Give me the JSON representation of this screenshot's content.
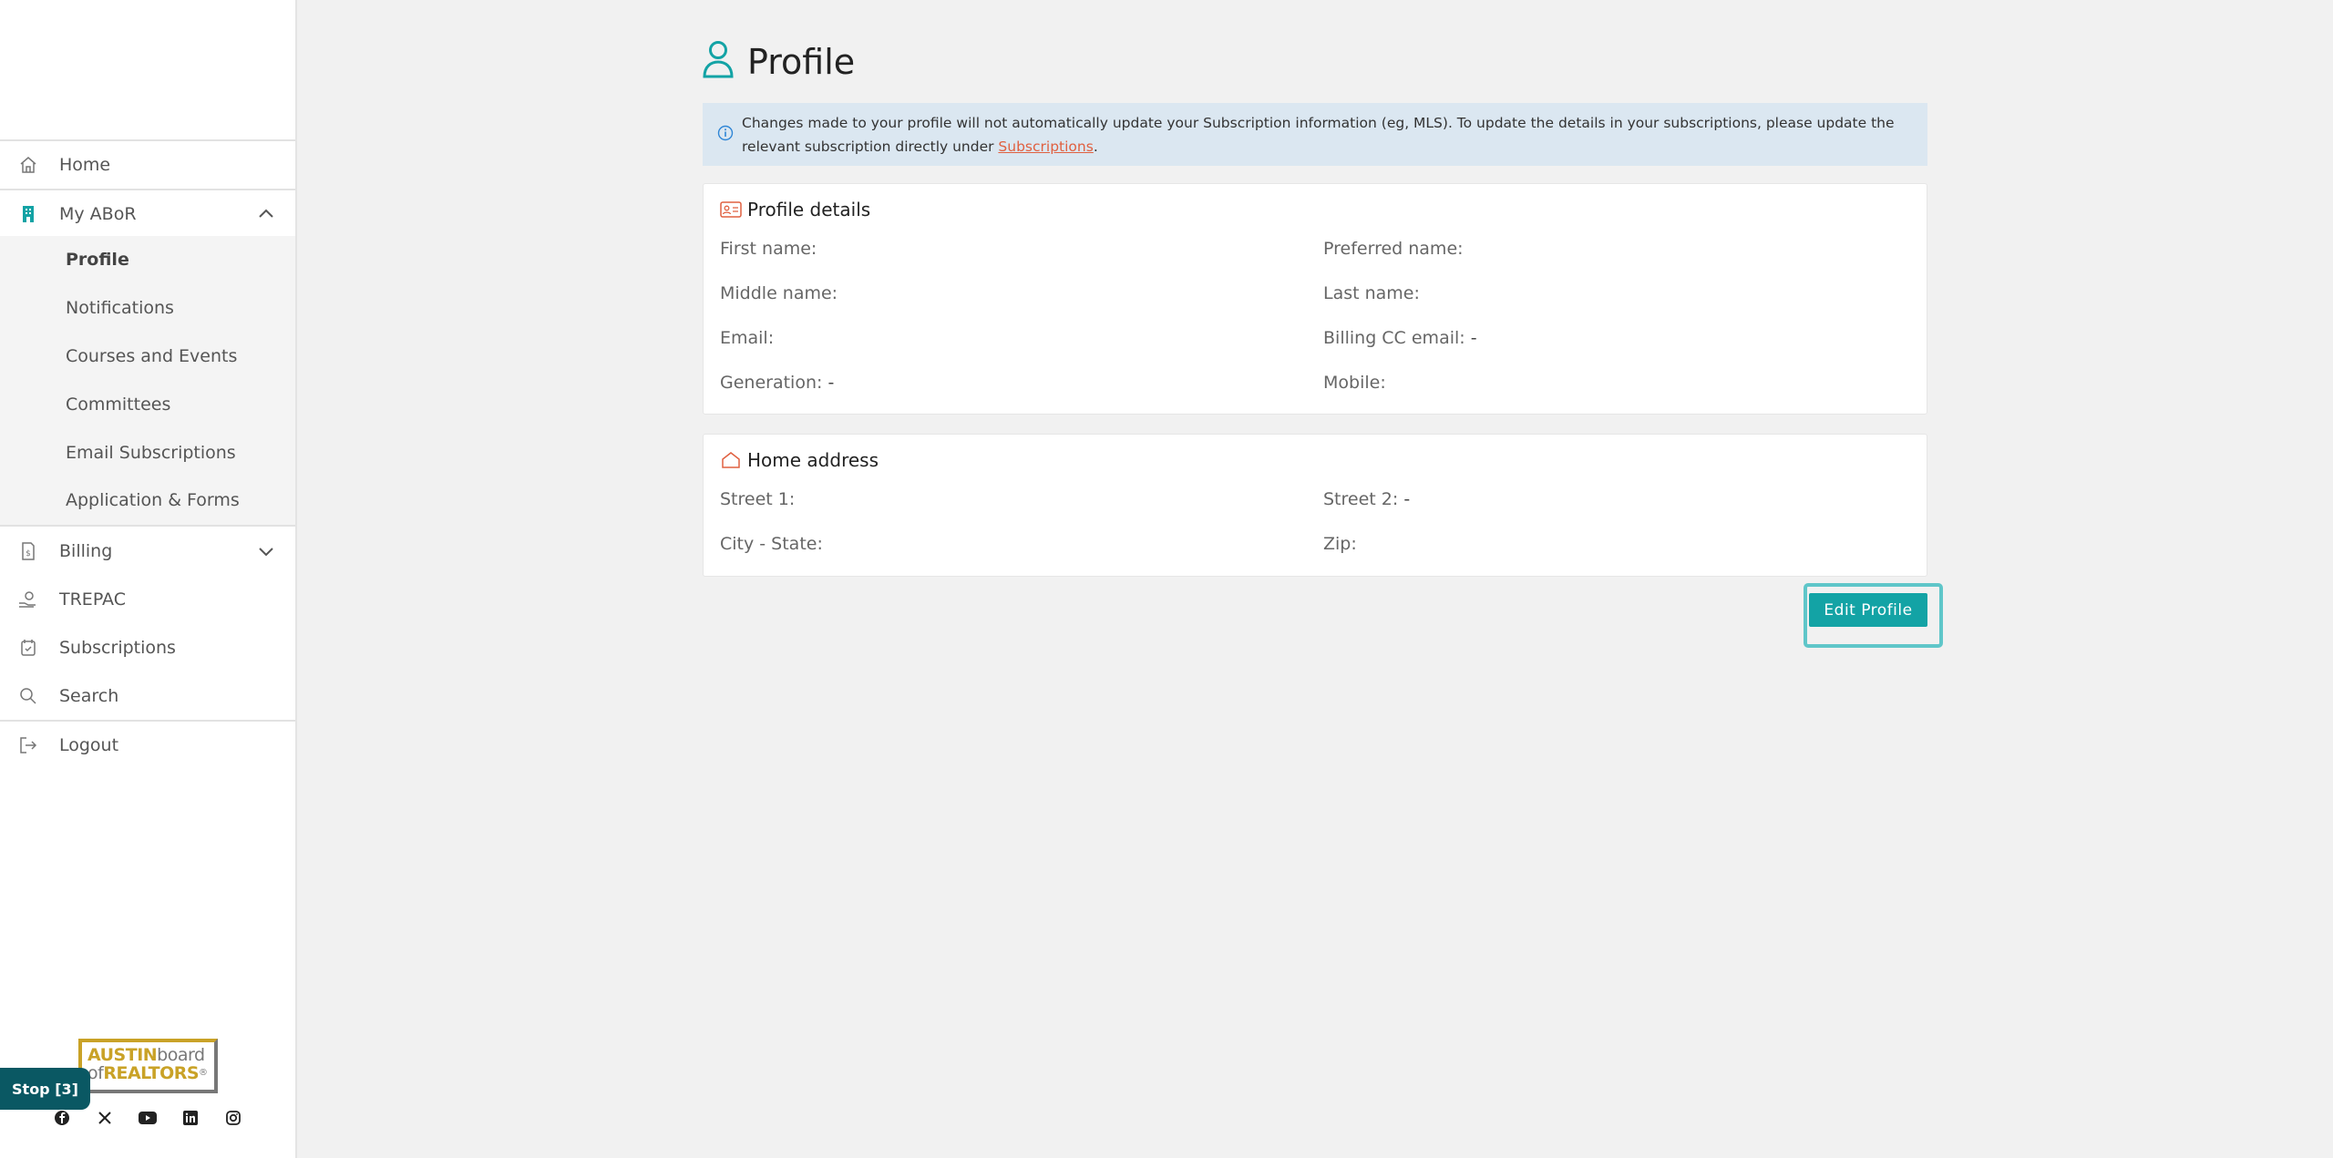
{
  "sidebar": {
    "items": [
      {
        "label": "Home",
        "icon": "home-icon"
      },
      {
        "label": "My ABoR",
        "icon": "building-icon"
      },
      {
        "label": "Billing",
        "icon": "invoice-icon"
      },
      {
        "label": "TREPAC",
        "icon": "hand-coin-icon"
      },
      {
        "label": "Subscriptions",
        "icon": "calendar-check-icon"
      },
      {
        "label": "Search",
        "icon": "search-icon"
      },
      {
        "label": "Logout",
        "icon": "logout-icon"
      }
    ],
    "sub_items": [
      {
        "label": "Profile",
        "active": true
      },
      {
        "label": "Notifications"
      },
      {
        "label": "Courses and Events"
      },
      {
        "label": "Committees"
      },
      {
        "label": "Email Subscriptions"
      },
      {
        "label": "Application & Forms"
      }
    ],
    "logo": {
      "line1_a": "AUSTIN",
      "line1_b": "board",
      "line2_a": "of",
      "line2_b": "REALTORS",
      "reg": "®"
    },
    "stop_button": "Stop [3]",
    "socials": [
      "facebook-icon",
      "x-icon",
      "youtube-icon",
      "linkedin-icon",
      "instagram-icon"
    ]
  },
  "page": {
    "title": "Profile",
    "alert_text": "Changes made to your profile will not automatically update your Subscription information (eg, MLS). To update the details in your subscriptions, please update the relevant subscription directly under ",
    "alert_link": "Subscriptions",
    "alert_end": "."
  },
  "profile_details": {
    "title": "Profile details",
    "fields": {
      "first_name": "First name:",
      "preferred_name": "Preferred name:",
      "middle_name": "Middle name:",
      "last_name": "Last name:",
      "email": "Email:",
      "billing_cc_email": "Billing CC email:",
      "billing_cc_email_value": "-",
      "generation": "Generation:",
      "generation_value": "-",
      "mobile": "Mobile:"
    }
  },
  "home_address": {
    "title": "Home address",
    "fields": {
      "street1": "Street 1:",
      "street2": "Street 2:",
      "street2_value": "-",
      "city_state": "City - State:",
      "zip": "Zip:"
    }
  },
  "actions": {
    "edit_profile": "Edit Profile"
  },
  "colors": {
    "accent": "#13a3a5",
    "link": "#e06040",
    "alert_bg": "#dbe7f1",
    "stop": "#0a5863"
  }
}
